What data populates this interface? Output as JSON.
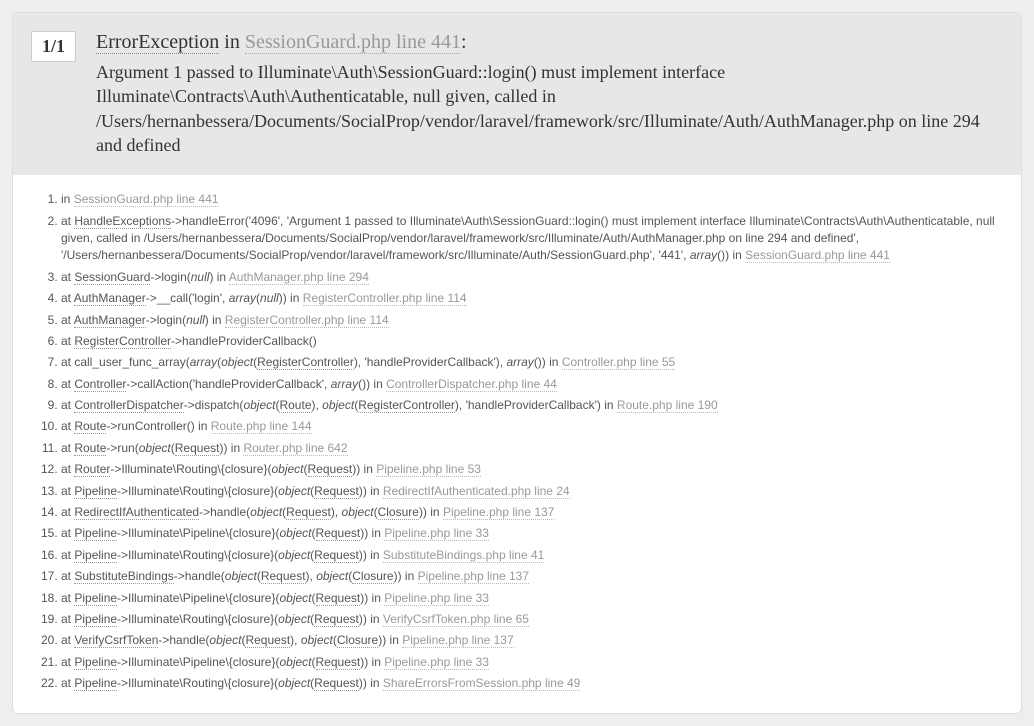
{
  "counter": "1/1",
  "title": {
    "exception": "ErrorException",
    "in_word": "in",
    "file": "SessionGuard.php line 441",
    "colon": ":"
  },
  "message": "Argument 1 passed to Illuminate\\Auth\\SessionGuard::login() must implement interface Illuminate\\Contracts\\Auth\\Authenticatable, null given, called in /Users/hernanbessera/Documents/SocialProp/vendor/laravel/framework/src/Illuminate/Auth/AuthManager.php on line 294 and defined",
  "trace": [
    {
      "segs": [
        {
          "t": "plain",
          "v": "in "
        },
        {
          "t": "file",
          "v": "SessionGuard.php line 441"
        }
      ]
    },
    {
      "segs": [
        {
          "t": "plain",
          "v": "at "
        },
        {
          "t": "cls",
          "v": "HandleExceptions"
        },
        {
          "t": "plain",
          "v": "->handleError('4096', 'Argument 1 passed to Illuminate\\Auth\\SessionGuard::login() must implement interface Illuminate\\Contracts\\Auth\\Authenticatable, null given, called in /Users/hernanbessera/Documents/SocialProp/vendor/laravel/framework/src/Illuminate/Auth/AuthManager.php on line 294 and defined', '/Users/hernanbessera/Documents/SocialProp/vendor/laravel/framework/src/Illuminate/Auth/SessionGuard.php', '441', "
        },
        {
          "t": "ital",
          "v": "array"
        },
        {
          "t": "plain",
          "v": "()) in "
        },
        {
          "t": "file",
          "v": "SessionGuard.php line 441"
        }
      ]
    },
    {
      "segs": [
        {
          "t": "plain",
          "v": "at "
        },
        {
          "t": "cls",
          "v": "SessionGuard"
        },
        {
          "t": "plain",
          "v": "->login("
        },
        {
          "t": "ital",
          "v": "null"
        },
        {
          "t": "plain",
          "v": ") in "
        },
        {
          "t": "file",
          "v": "AuthManager.php line 294"
        }
      ]
    },
    {
      "segs": [
        {
          "t": "plain",
          "v": "at "
        },
        {
          "t": "cls",
          "v": "AuthManager"
        },
        {
          "t": "plain",
          "v": "->__call('login', "
        },
        {
          "t": "ital",
          "v": "array"
        },
        {
          "t": "plain",
          "v": "("
        },
        {
          "t": "ital",
          "v": "null"
        },
        {
          "t": "plain",
          "v": ")) in "
        },
        {
          "t": "file",
          "v": "RegisterController.php line 114"
        }
      ]
    },
    {
      "segs": [
        {
          "t": "plain",
          "v": "at "
        },
        {
          "t": "cls",
          "v": "AuthManager"
        },
        {
          "t": "plain",
          "v": "->login("
        },
        {
          "t": "ital",
          "v": "null"
        },
        {
          "t": "plain",
          "v": ") in "
        },
        {
          "t": "file",
          "v": "RegisterController.php line 114"
        }
      ]
    },
    {
      "segs": [
        {
          "t": "plain",
          "v": "at "
        },
        {
          "t": "cls",
          "v": "RegisterController"
        },
        {
          "t": "plain",
          "v": "->handleProviderCallback()"
        }
      ]
    },
    {
      "segs": [
        {
          "t": "plain",
          "v": "at call_user_func_array("
        },
        {
          "t": "ital",
          "v": "array"
        },
        {
          "t": "plain",
          "v": "("
        },
        {
          "t": "ital",
          "v": "object"
        },
        {
          "t": "plain",
          "v": "("
        },
        {
          "t": "obj",
          "v": "RegisterController"
        },
        {
          "t": "plain",
          "v": "), 'handleProviderCallback'), "
        },
        {
          "t": "ital",
          "v": "array"
        },
        {
          "t": "plain",
          "v": "()) in "
        },
        {
          "t": "file",
          "v": "Controller.php line 55"
        }
      ]
    },
    {
      "segs": [
        {
          "t": "plain",
          "v": "at "
        },
        {
          "t": "cls",
          "v": "Controller"
        },
        {
          "t": "plain",
          "v": "->callAction('handleProviderCallback', "
        },
        {
          "t": "ital",
          "v": "array"
        },
        {
          "t": "plain",
          "v": "()) in "
        },
        {
          "t": "file",
          "v": "ControllerDispatcher.php line 44"
        }
      ]
    },
    {
      "segs": [
        {
          "t": "plain",
          "v": "at "
        },
        {
          "t": "cls",
          "v": "ControllerDispatcher"
        },
        {
          "t": "plain",
          "v": "->dispatch("
        },
        {
          "t": "ital",
          "v": "object"
        },
        {
          "t": "plain",
          "v": "("
        },
        {
          "t": "obj",
          "v": "Route"
        },
        {
          "t": "plain",
          "v": "), "
        },
        {
          "t": "ital",
          "v": "object"
        },
        {
          "t": "plain",
          "v": "("
        },
        {
          "t": "obj",
          "v": "RegisterController"
        },
        {
          "t": "plain",
          "v": "), 'handleProviderCallback') in "
        },
        {
          "t": "file",
          "v": "Route.php line 190"
        }
      ]
    },
    {
      "segs": [
        {
          "t": "plain",
          "v": "at "
        },
        {
          "t": "cls",
          "v": "Route"
        },
        {
          "t": "plain",
          "v": "->runController() in "
        },
        {
          "t": "file",
          "v": "Route.php line 144"
        }
      ]
    },
    {
      "segs": [
        {
          "t": "plain",
          "v": "at "
        },
        {
          "t": "cls",
          "v": "Route"
        },
        {
          "t": "plain",
          "v": "->run("
        },
        {
          "t": "ital",
          "v": "object"
        },
        {
          "t": "plain",
          "v": "("
        },
        {
          "t": "obj",
          "v": "Request"
        },
        {
          "t": "plain",
          "v": ")) in "
        },
        {
          "t": "file",
          "v": "Router.php line 642"
        }
      ]
    },
    {
      "segs": [
        {
          "t": "plain",
          "v": "at "
        },
        {
          "t": "cls",
          "v": "Router"
        },
        {
          "t": "plain",
          "v": "->Illuminate\\Routing\\{closure}("
        },
        {
          "t": "ital",
          "v": "object"
        },
        {
          "t": "plain",
          "v": "("
        },
        {
          "t": "obj",
          "v": "Request"
        },
        {
          "t": "plain",
          "v": ")) in "
        },
        {
          "t": "file",
          "v": "Pipeline.php line 53"
        }
      ]
    },
    {
      "segs": [
        {
          "t": "plain",
          "v": "at "
        },
        {
          "t": "cls",
          "v": "Pipeline"
        },
        {
          "t": "plain",
          "v": "->Illuminate\\Routing\\{closure}("
        },
        {
          "t": "ital",
          "v": "object"
        },
        {
          "t": "plain",
          "v": "("
        },
        {
          "t": "obj",
          "v": "Request"
        },
        {
          "t": "plain",
          "v": ")) in "
        },
        {
          "t": "file",
          "v": "RedirectIfAuthenticated.php line 24"
        }
      ]
    },
    {
      "segs": [
        {
          "t": "plain",
          "v": "at "
        },
        {
          "t": "cls",
          "v": "RedirectIfAuthenticated"
        },
        {
          "t": "plain",
          "v": "->handle("
        },
        {
          "t": "ital",
          "v": "object"
        },
        {
          "t": "plain",
          "v": "("
        },
        {
          "t": "obj",
          "v": "Request"
        },
        {
          "t": "plain",
          "v": "), "
        },
        {
          "t": "ital",
          "v": "object"
        },
        {
          "t": "plain",
          "v": "("
        },
        {
          "t": "obj",
          "v": "Closure"
        },
        {
          "t": "plain",
          "v": ")) in "
        },
        {
          "t": "file",
          "v": "Pipeline.php line 137"
        }
      ]
    },
    {
      "segs": [
        {
          "t": "plain",
          "v": "at "
        },
        {
          "t": "cls",
          "v": "Pipeline"
        },
        {
          "t": "plain",
          "v": "->Illuminate\\Pipeline\\{closure}("
        },
        {
          "t": "ital",
          "v": "object"
        },
        {
          "t": "plain",
          "v": "("
        },
        {
          "t": "obj",
          "v": "Request"
        },
        {
          "t": "plain",
          "v": ")) in "
        },
        {
          "t": "file",
          "v": "Pipeline.php line 33"
        }
      ]
    },
    {
      "segs": [
        {
          "t": "plain",
          "v": "at "
        },
        {
          "t": "cls",
          "v": "Pipeline"
        },
        {
          "t": "plain",
          "v": "->Illuminate\\Routing\\{closure}("
        },
        {
          "t": "ital",
          "v": "object"
        },
        {
          "t": "plain",
          "v": "("
        },
        {
          "t": "obj",
          "v": "Request"
        },
        {
          "t": "plain",
          "v": ")) in "
        },
        {
          "t": "file",
          "v": "SubstituteBindings.php line 41"
        }
      ]
    },
    {
      "segs": [
        {
          "t": "plain",
          "v": "at "
        },
        {
          "t": "cls",
          "v": "SubstituteBindings"
        },
        {
          "t": "plain",
          "v": "->handle("
        },
        {
          "t": "ital",
          "v": "object"
        },
        {
          "t": "plain",
          "v": "("
        },
        {
          "t": "obj",
          "v": "Request"
        },
        {
          "t": "plain",
          "v": "), "
        },
        {
          "t": "ital",
          "v": "object"
        },
        {
          "t": "plain",
          "v": "("
        },
        {
          "t": "obj",
          "v": "Closure"
        },
        {
          "t": "plain",
          "v": ")) in "
        },
        {
          "t": "file",
          "v": "Pipeline.php line 137"
        }
      ]
    },
    {
      "segs": [
        {
          "t": "plain",
          "v": "at "
        },
        {
          "t": "cls",
          "v": "Pipeline"
        },
        {
          "t": "plain",
          "v": "->Illuminate\\Pipeline\\{closure}("
        },
        {
          "t": "ital",
          "v": "object"
        },
        {
          "t": "plain",
          "v": "("
        },
        {
          "t": "obj",
          "v": "Request"
        },
        {
          "t": "plain",
          "v": ")) in "
        },
        {
          "t": "file",
          "v": "Pipeline.php line 33"
        }
      ]
    },
    {
      "segs": [
        {
          "t": "plain",
          "v": "at "
        },
        {
          "t": "cls",
          "v": "Pipeline"
        },
        {
          "t": "plain",
          "v": "->Illuminate\\Routing\\{closure}("
        },
        {
          "t": "ital",
          "v": "object"
        },
        {
          "t": "plain",
          "v": "("
        },
        {
          "t": "obj",
          "v": "Request"
        },
        {
          "t": "plain",
          "v": ")) in "
        },
        {
          "t": "file",
          "v": "VerifyCsrfToken.php line 65"
        }
      ]
    },
    {
      "segs": [
        {
          "t": "plain",
          "v": "at "
        },
        {
          "t": "cls",
          "v": "VerifyCsrfToken"
        },
        {
          "t": "plain",
          "v": "->handle("
        },
        {
          "t": "ital",
          "v": "object"
        },
        {
          "t": "plain",
          "v": "("
        },
        {
          "t": "obj",
          "v": "Request"
        },
        {
          "t": "plain",
          "v": "), "
        },
        {
          "t": "ital",
          "v": "object"
        },
        {
          "t": "plain",
          "v": "("
        },
        {
          "t": "obj",
          "v": "Closure"
        },
        {
          "t": "plain",
          "v": ")) in "
        },
        {
          "t": "file",
          "v": "Pipeline.php line 137"
        }
      ]
    },
    {
      "segs": [
        {
          "t": "plain",
          "v": "at "
        },
        {
          "t": "cls",
          "v": "Pipeline"
        },
        {
          "t": "plain",
          "v": "->Illuminate\\Pipeline\\{closure}("
        },
        {
          "t": "ital",
          "v": "object"
        },
        {
          "t": "plain",
          "v": "("
        },
        {
          "t": "obj",
          "v": "Request"
        },
        {
          "t": "plain",
          "v": ")) in "
        },
        {
          "t": "file",
          "v": "Pipeline.php line 33"
        }
      ]
    },
    {
      "segs": [
        {
          "t": "plain",
          "v": "at "
        },
        {
          "t": "cls",
          "v": "Pipeline"
        },
        {
          "t": "plain",
          "v": "->Illuminate\\Routing\\{closure}("
        },
        {
          "t": "ital",
          "v": "object"
        },
        {
          "t": "plain",
          "v": "("
        },
        {
          "t": "obj",
          "v": "Request"
        },
        {
          "t": "plain",
          "v": ")) in "
        },
        {
          "t": "file",
          "v": "ShareErrorsFromSession.php line 49"
        }
      ]
    }
  ]
}
